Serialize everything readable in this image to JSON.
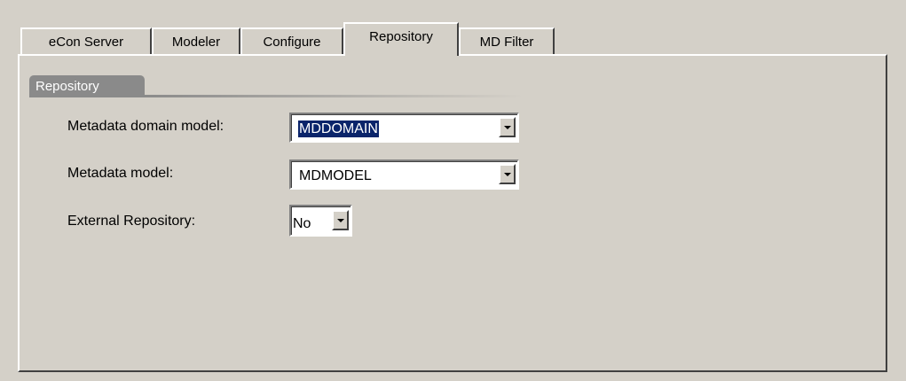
{
  "tabs": [
    {
      "label": "eCon Server",
      "selected": false
    },
    {
      "label": "Modeler",
      "selected": false
    },
    {
      "label": "Configure",
      "selected": false
    },
    {
      "label": "Repository",
      "selected": true
    },
    {
      "label": "MD Filter",
      "selected": false
    }
  ],
  "group": {
    "title": "Repository"
  },
  "fields": {
    "metadata_domain_model": {
      "label": "Metadata domain  model:",
      "value": "MDDOMAIN",
      "selected_text": true
    },
    "metadata_model": {
      "label": "Metadata model:",
      "value": "MDMODEL"
    },
    "external_repository": {
      "label": "External Repository:",
      "value": "No"
    }
  },
  "colors": {
    "background": "#d4d0c8",
    "group_header": "#8a8a8a",
    "selection": "#0a246a"
  },
  "icons": {
    "dropdown": "chevron-down-icon"
  }
}
